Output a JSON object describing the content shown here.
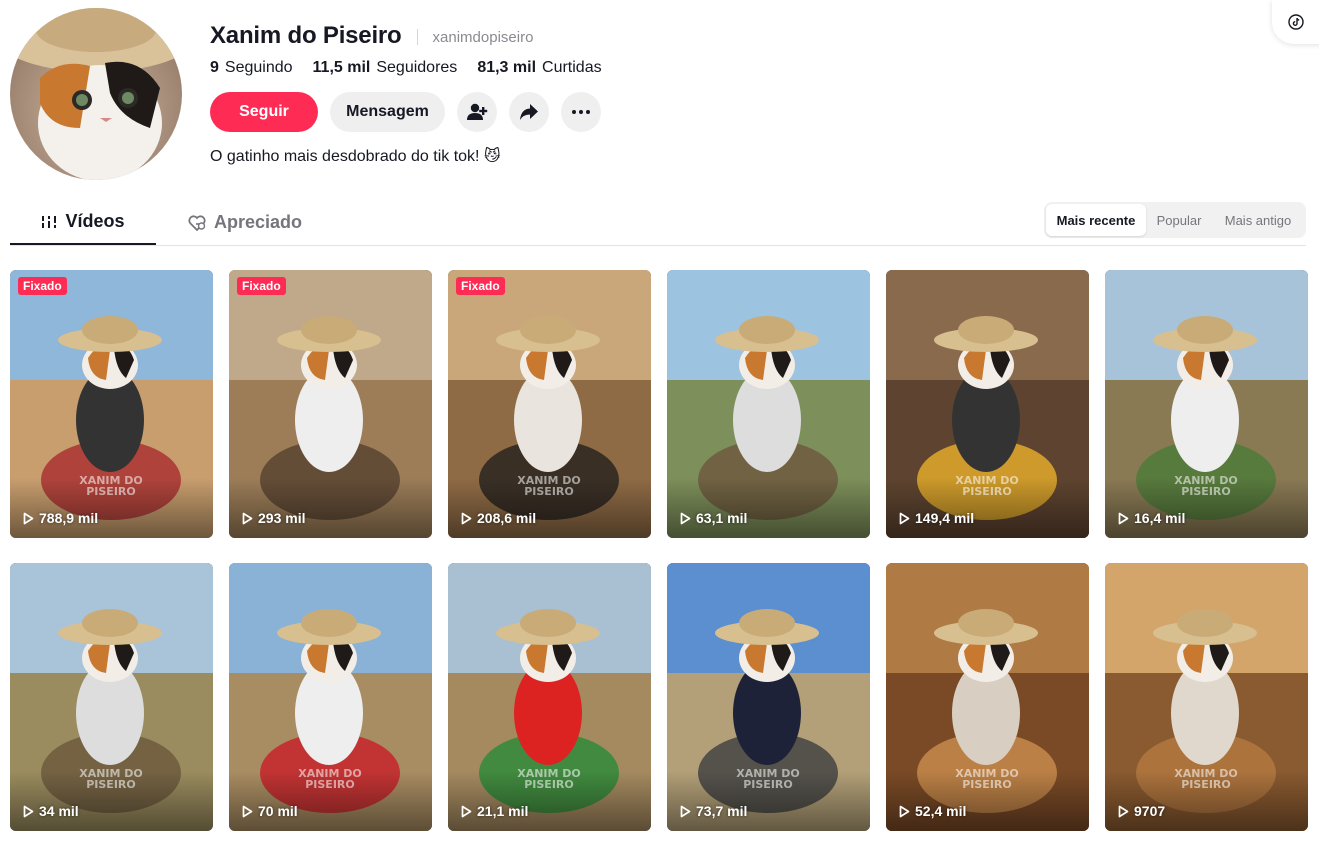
{
  "profile": {
    "display_name": "Xanim do Piseiro",
    "username": "xanimdopiseiro",
    "bio": "O gatinho mais desdobrado do tik tok! 😼",
    "stats": [
      {
        "value": "9",
        "label": "Seguindo"
      },
      {
        "value": "11,5 mil",
        "label": "Seguidores"
      },
      {
        "value": "81,3 mil",
        "label": "Curtidas"
      }
    ],
    "follow_label": "Seguir",
    "message_label": "Mensagem"
  },
  "tabs": [
    {
      "label": "Vídeos",
      "icon": "grid-bars-icon",
      "active": true
    },
    {
      "label": "Apreciado",
      "icon": "heart-hidden-icon",
      "active": false
    }
  ],
  "sort": {
    "options": [
      "Mais recente",
      "Popular",
      "Mais antigo"
    ],
    "selected": "Mais recente"
  },
  "videos": [
    {
      "views": "788,9 mil",
      "pinned": "Fixado",
      "watermark": "XANIM DO PISEIRO"
    },
    {
      "views": "293 mil",
      "pinned": "Fixado",
      "watermark": ""
    },
    {
      "views": "208,6 mil",
      "pinned": "Fixado",
      "watermark": "XANIM DO PISEIRO"
    },
    {
      "views": "63,1 mil",
      "pinned": "",
      "watermark": ""
    },
    {
      "views": "149,4 mil",
      "pinned": "",
      "watermark": "XANIM DO PISEIRO"
    },
    {
      "views": "16,4 mil",
      "pinned": "",
      "watermark": "XANIM DO PISEIRO"
    },
    {
      "views": "34 mil",
      "pinned": "",
      "watermark": "XANIM DO PISEIRO"
    },
    {
      "views": "70 mil",
      "pinned": "",
      "watermark": "XANIM DO PISEIRO"
    },
    {
      "views": "21,1 mil",
      "pinned": "",
      "watermark": "XANIM DO PISEIRO"
    },
    {
      "views": "73,7 mil",
      "pinned": "",
      "watermark": "XANIM DO PISEIRO"
    },
    {
      "views": "52,4 mil",
      "pinned": "",
      "watermark": "XANIM DO PISEIRO"
    },
    {
      "views": "9707",
      "pinned": "",
      "watermark": "XANIM DO PISEIRO"
    }
  ],
  "colors": {
    "accent": "#fe2c55",
    "text": "#161823",
    "muted": "#75767c"
  }
}
